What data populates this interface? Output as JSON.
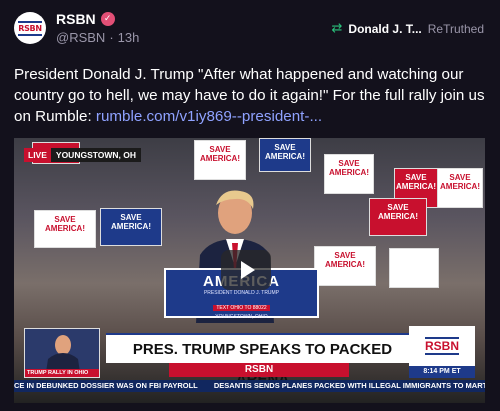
{
  "account": {
    "display_name": "RSBN",
    "handle": "@RSBN",
    "separator": "·",
    "time_ago": "13h",
    "avatar_text": "RSBN"
  },
  "retruth": {
    "name": "Donald J. T...",
    "label": "ReTruthed"
  },
  "post": {
    "text": "President Donald J. Trump \"After what happened and watching our country go to hell, we may have to do it again!\" For the full rally join us on Rumble: ",
    "link": "rumble.com/v1iy869--president-..."
  },
  "media": {
    "live_tag": "LIVE",
    "location": "YOUNGSTOWN, OH",
    "signs": [
      "SAVE AMERICA!",
      "SAVE AMERICA!",
      "SAVE AMERICA!",
      "SAVE AMERICA!",
      "SAVE AMERICA!",
      "SAVE AMERICA!",
      "SAVE AMERICA!",
      "SAVE AMERICA!",
      "SAVE AMERICA!"
    ],
    "podium_title": "AMERICA",
    "podium_sub": "PRESIDENT DONALD J. TRUMP",
    "podium_text": "TEXT OHIO TO 88022",
    "podium_city": "YOUNGSTOWN, OHIO",
    "thumb_caption": "TRUMP RALLY IN OHIO",
    "headline": "PRES. TRUMP SPEAKS TO PACKED ARENA",
    "brand": "RSBN",
    "logo": "RSBN",
    "time": "8:14 PM ET",
    "ticker": [
      "CE IN DEBUNKED DOSSIER WAS ON FBI PAYROLL",
      "DESANTIS SENDS PLANES PACKED WITH ILLEGAL IMMIGRANTS TO MARTHA'S"
    ]
  },
  "colors": {
    "background": "#13111c",
    "link": "#8fa2ff",
    "verified": "#e24f76",
    "retruth": "#2ac17b",
    "brand_red": "#c8102e",
    "brand_blue": "#1e3a8a"
  }
}
